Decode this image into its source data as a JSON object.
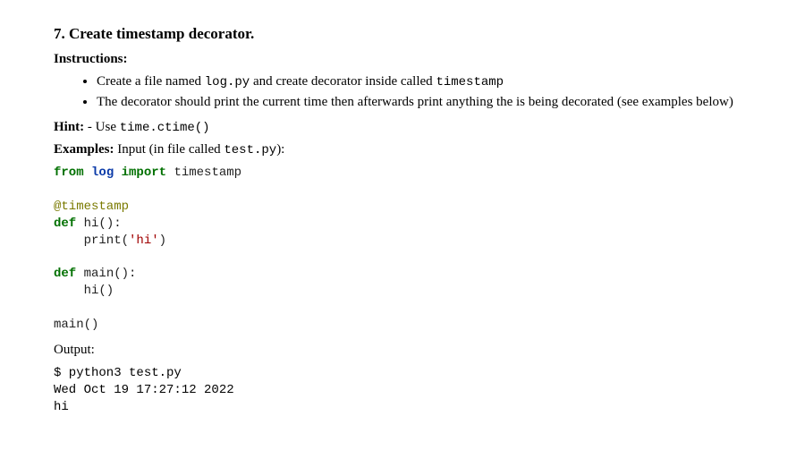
{
  "heading": "7. Create timestamp decorator.",
  "instructions_label": "Instructions:",
  "bullets": [
    {
      "pre": "Create a file named ",
      "code1": "log.py",
      "mid": " and create decorator inside called ",
      "code2": "timestamp"
    },
    {
      "text": "The decorator should print the current time then afterwards print anything the is being decorated (see examples below)"
    }
  ],
  "hint_label": "Hint:",
  "hint_text": " - Use ",
  "hint_code": "time.ctime()",
  "examples_label": "Examples:",
  "examples_text": " Input (in file called ",
  "examples_code": "test.py",
  "examples_text2": "):",
  "code": {
    "l1_from": "from",
    "l1_mod": " log ",
    "l1_import": "import",
    "l1_name": " timestamp",
    "blank1": "",
    "l2_dec": "@timestamp",
    "l3_def": "def",
    "l3_rest": " hi():",
    "l4_indent": "    print(",
    "l4_str": "'hi'",
    "l4_close": ")",
    "blank2": "",
    "l5_def": "def",
    "l5_rest": " main():",
    "l6": "    hi()",
    "blank3": "",
    "l7": "main()"
  },
  "output_label": "Output:",
  "output": {
    "l1": "$ python3 test.py",
    "l2": "Wed Oct 19 17:27:12 2022",
    "l3": "hi"
  }
}
